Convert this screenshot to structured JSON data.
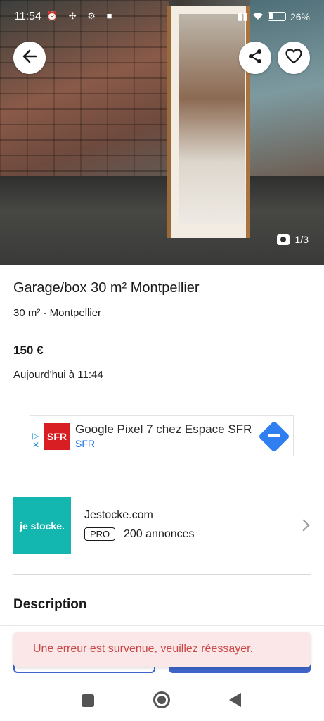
{
  "status_bar": {
    "time": "11:54",
    "left_icons": "⏰ ✣ ⚙ ■",
    "signal": "▮▮",
    "battery": "26%"
  },
  "hero": {
    "photo_counter": "1/3",
    "icons": {
      "back": "arrow-left-icon",
      "share": "share-icon",
      "favorite": "heart-icon",
      "camera": "camera-icon"
    }
  },
  "listing": {
    "title": "Garage/box 30 m² Montpellier",
    "subtitle": "30 m² · Montpellier",
    "price": "150 €",
    "date": "Aujourd'hui à 11:44"
  },
  "ad": {
    "adchoices": "▷\n✕",
    "logo_text": "SFR",
    "title": "Google Pixel 7 chez Espace SFR",
    "advertiser": "SFR"
  },
  "seller": {
    "logo_text": "je stocke.",
    "name": "Jestocke.com",
    "badge": "PRO",
    "listings_count": "200 annonces"
  },
  "description": {
    "heading": "Description"
  },
  "toast": {
    "message": "Une erreur est survenue, veuillez réessayer."
  },
  "colors": {
    "accent": "#3e63c9",
    "error_text": "#c94747",
    "error_bg": "#fbe7e7",
    "seller_brand": "#14b7b0",
    "sfr_brand": "#d81e22"
  }
}
